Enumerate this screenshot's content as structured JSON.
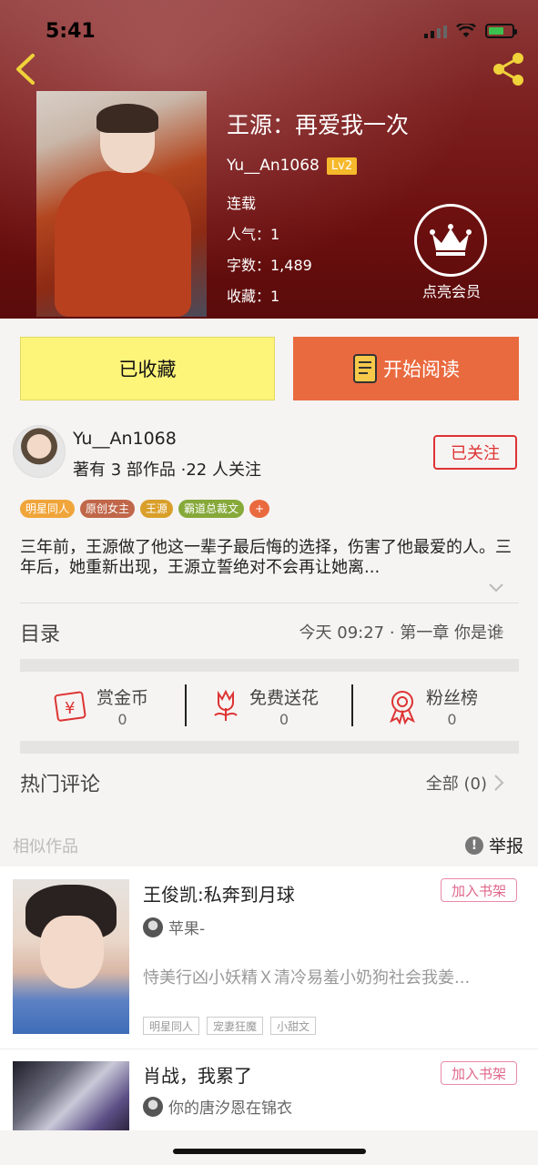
{
  "status": {
    "time": "5:41"
  },
  "book": {
    "title": "王源：再爱我一次",
    "author": "Yu__An1068",
    "level": "Lv2",
    "status": "连载",
    "popularity": "人气：1",
    "words": "字数：1,489",
    "favorites": "收藏：1",
    "vip_label": "点亮会员"
  },
  "actions": {
    "favorited": "已收藏",
    "start_reading": "开始阅读"
  },
  "author_card": {
    "name": "Yu__An1068",
    "info": "著有 3 部作品 ·22 人关注",
    "follow": "已关注"
  },
  "tags": [
    {
      "label": "明星同人",
      "color": "#f0a53a"
    },
    {
      "label": "原创女主",
      "color": "#c0674a"
    },
    {
      "label": "王源",
      "color": "#d99f2a"
    },
    {
      "label": "霸道总裁文",
      "color": "#86a93a"
    },
    {
      "label": "+",
      "color": "#ea6a3f"
    }
  ],
  "description": "三年前，王源做了他这一辈子最后悔的选择，伤害了他最爱的人。三年后，她重新出现，王源立誓绝对不会再让她离...",
  "toc": {
    "label": "目录",
    "latest": "今天 09:27 · 第一章 你是谁"
  },
  "stats": [
    {
      "label": "赏金币",
      "value": "0",
      "icon": "gold-coin-icon"
    },
    {
      "label": "免费送花",
      "value": "0",
      "icon": "flower-icon"
    },
    {
      "label": "粉丝榜",
      "value": "0",
      "icon": "medal-icon"
    }
  ],
  "comments": {
    "label": "热门评论",
    "all": "全部 (0)"
  },
  "similar": {
    "label": "相似作品",
    "report": "举报"
  },
  "works": [
    {
      "title": "王俊凯:私奔到月球",
      "add": "加入书架",
      "author": "苹果-",
      "synopsis": "恃美行凶小妖精Ｘ清冷易羞小奶狗社会我姜...",
      "tags": [
        "明星同人",
        "宠妻狂魔",
        "小甜文"
      ]
    },
    {
      "title": "肖战，我累了",
      "add": "加入书架",
      "author": "你的唐汐恩在锦衣"
    }
  ],
  "colors": {
    "accent": "#ea6a3f",
    "favorite_bg": "#fdf47a",
    "follow": "#dd3333"
  }
}
